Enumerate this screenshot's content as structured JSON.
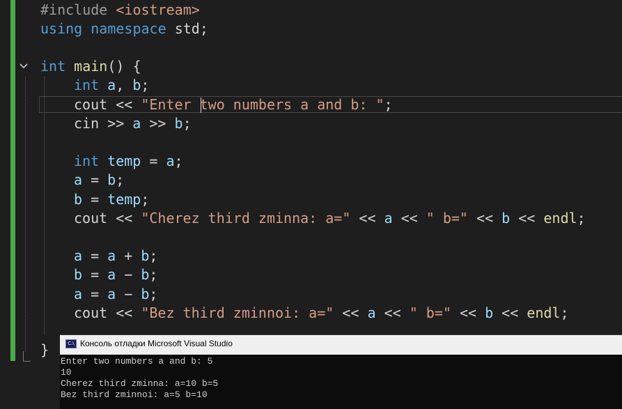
{
  "editor": {
    "lines": {
      "l1": {
        "directive": "#include",
        "header": "<iostream>"
      },
      "l2": {
        "kw1": "using",
        "kw2": "namespace",
        "name": "std",
        "semi": ";"
      },
      "l4": {
        "type": "int",
        "fn": "main",
        "rest": "() {"
      },
      "l5": {
        "type": "int",
        "a": "a",
        "comma": ", ",
        "b": "b",
        "semi": ";"
      },
      "l6": {
        "cout": "cout",
        "op": " << ",
        "str": "\"Enter two numbers a and b: \"",
        "semi": ";"
      },
      "l7": {
        "cin": "cin",
        "op1": " >> ",
        "a": "a",
        "op2": " >> ",
        "b": "b",
        "semi": ";"
      },
      "l9": {
        "type": "int",
        "name": "temp",
        "eq": " = ",
        "a": "a",
        "semi": ";"
      },
      "l10": {
        "a": "a",
        "eq": " = ",
        "b": "b",
        "semi": ";"
      },
      "l11": {
        "b": "b",
        "eq": " = ",
        "temp": "temp",
        "semi": ";"
      },
      "l12": {
        "cout": "cout",
        "op1": " << ",
        "str1": "\"Cherez third zminna: a=\"",
        "op2": " << ",
        "a": "a",
        "op3": " << ",
        "str2": "\" b=\"",
        "op4": " << ",
        "b": "b",
        "op5": " << ",
        "endl": "endl",
        "semi": ";"
      },
      "l14": {
        "a1": "a",
        "eq": " = ",
        "a2": "a",
        "plus": " + ",
        "b": "b",
        "semi": ";"
      },
      "l15": {
        "b1": "b",
        "eq": " = ",
        "a": "a",
        "minus": " − ",
        "b2": "b",
        "semi": ";"
      },
      "l16": {
        "a1": "a",
        "eq": " = ",
        "a2": "a",
        "minus": " − ",
        "b": "b",
        "semi": ";"
      },
      "l17": {
        "cout": "cout",
        "op1": " << ",
        "str1": "\"Bez third zminnoi: a=\"",
        "op2": " << ",
        "a": "a",
        "op3": " << ",
        "str2": "\" b=\"",
        "op4": " << ",
        "b": "b",
        "op5": " << ",
        "endl": "endl",
        "semi": ";"
      },
      "l19": {
        "brace": "}"
      }
    },
    "fold_icon": "chevron-down-icon"
  },
  "console": {
    "title": "Консоль отладки Microsoft Visual Studio",
    "icon_text": "C:\\",
    "output": [
      "Enter two numbers a and b: 5",
      "10",
      "Cherez third zminna: a=10 b=5",
      "Bez third zminnoi: a=5 b=10"
    ]
  },
  "colors": {
    "background": "#1e1e1e",
    "keyword": "#569cd6",
    "string": "#d69d85",
    "function": "#dcdcaa",
    "variable": "#9cdcfe",
    "change_bar": "#4ea94b"
  }
}
